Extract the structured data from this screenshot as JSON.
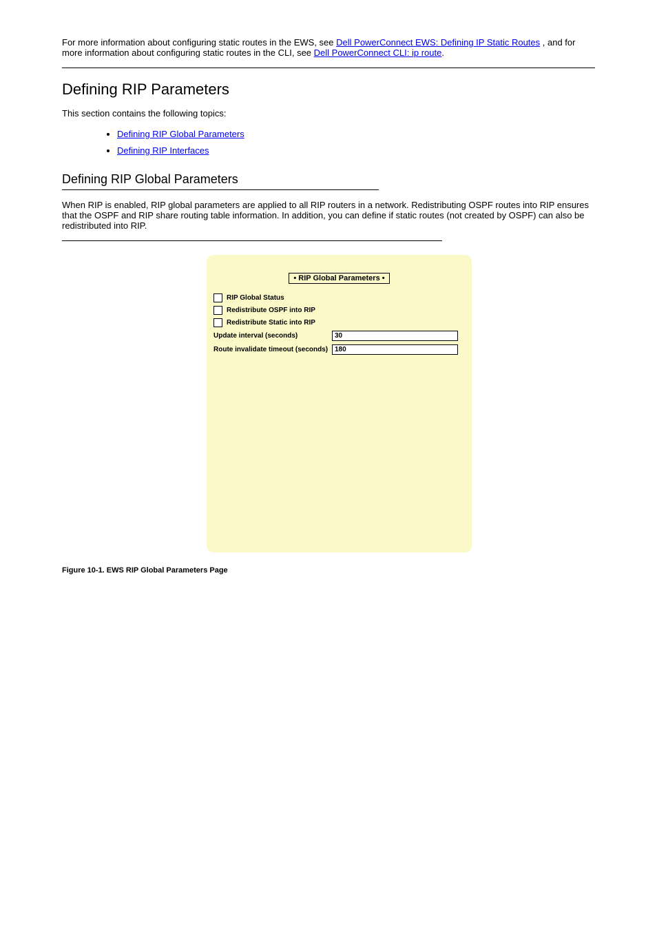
{
  "paragraph1_before": "For more information about configuring static routes in the EWS, see ",
  "paragraph1_link": "Dell PowerConnect EWS: Defining IP Static Routes",
  "paragraph1_after": ", and for more information about configuring static routes in the CLI, see ",
  "paragraph1_link2": "Dell PowerConnect CLI: ip route",
  "paragraph1_end": ".",
  "section_heading": "Defining RIP Parameters",
  "section_intro": "This section contains the following topics:",
  "bullet1": "Defining RIP Global Parameters",
  "bullet2": "Defining RIP Interfaces",
  "subsection_heading": "Defining RIP Global Parameters",
  "subsection_para1": "When RIP is enabled, RIP global parameters are applied to all RIP routers in a network. Redistributing OSPF routes into RIP ensures that the OSPF and RIP share routing table information. In addition, you can define if static routes (not created by OSPF) can also be redistributed into RIP.",
  "panel": {
    "title": "• RIP Global Parameters •",
    "rows": {
      "status": "RIP Global Status",
      "redist_ospf": "Redistribute OSPF into RIP",
      "redist_static": "Redistribute Static into RIP",
      "update_interval_label": "Update interval (seconds)",
      "update_interval_value": "30",
      "route_invalidate_label": "Route invalidate timeout (seconds)",
      "route_invalidate_value": "180"
    }
  },
  "figure_caption": "Figure 10-1. EWS RIP Global Parameters Page"
}
